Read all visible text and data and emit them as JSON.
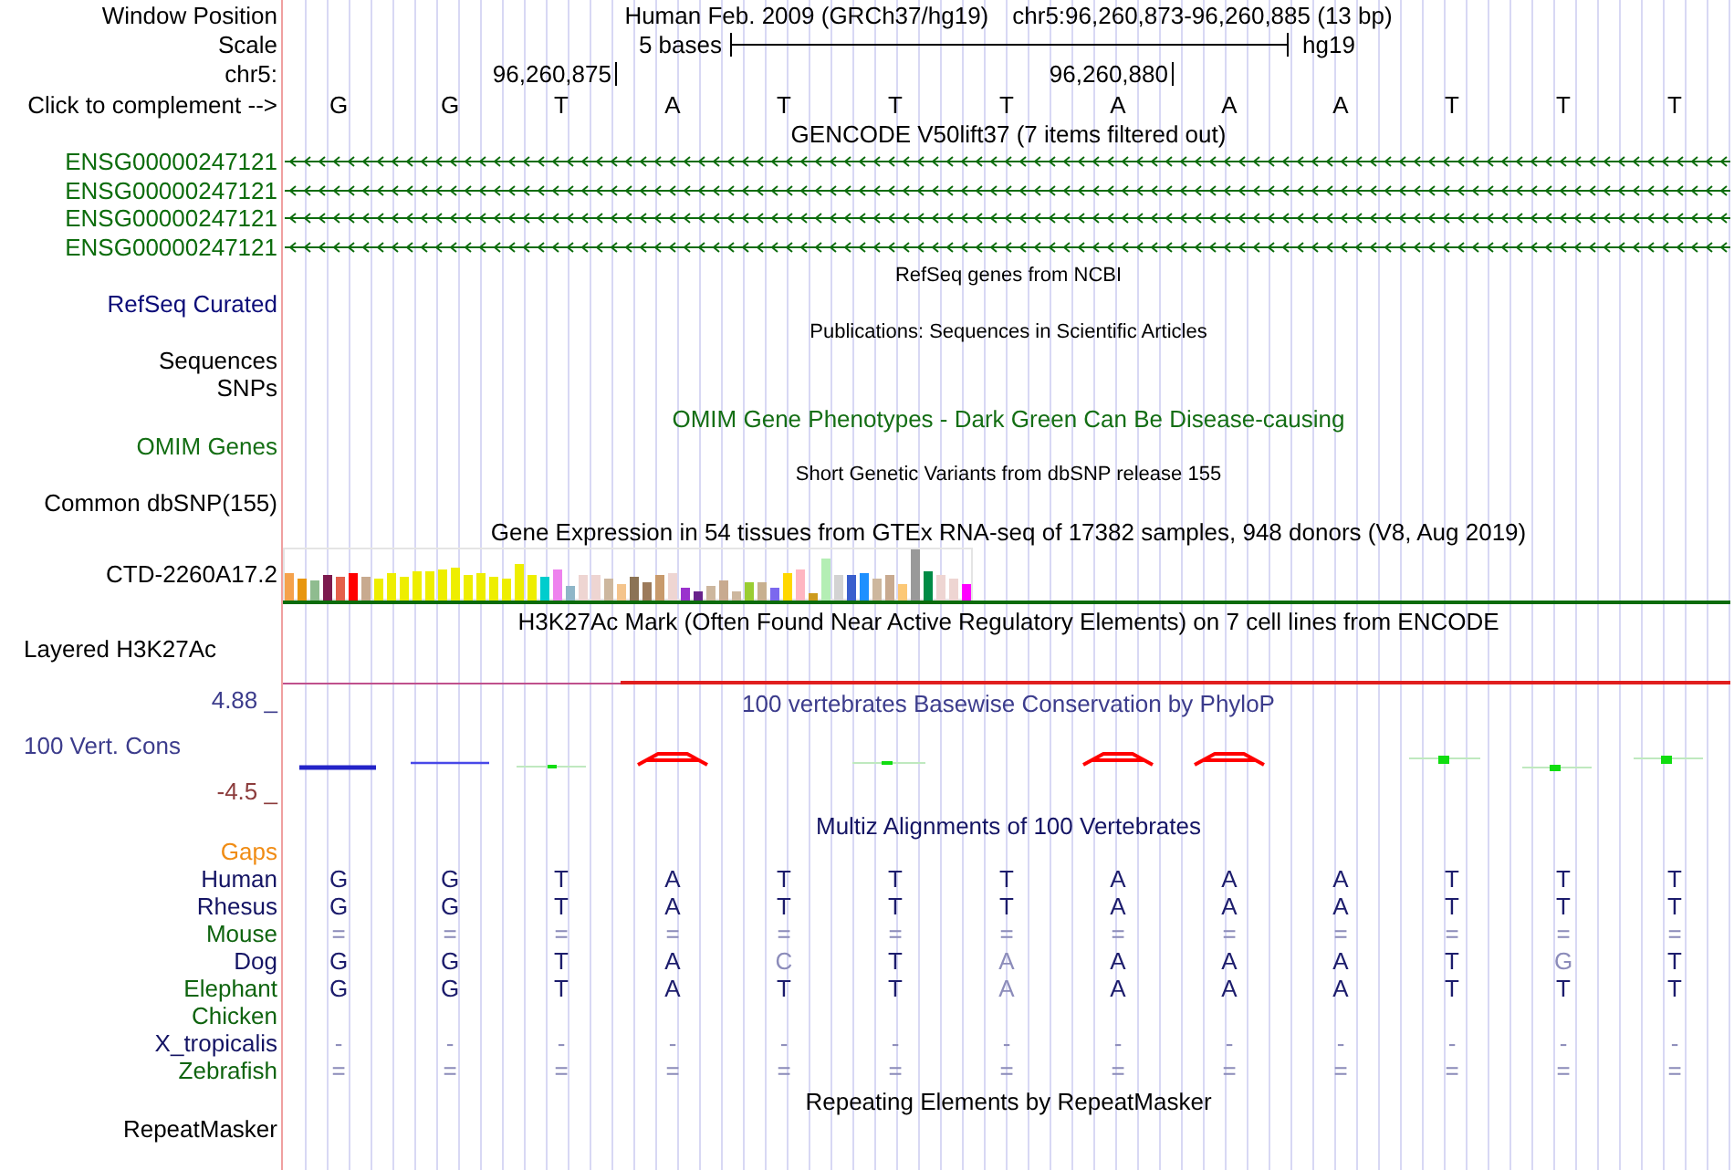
{
  "header": {
    "label": "Window Position",
    "title": "Human Feb. 2009 (GRCh37/hg19)",
    "position": "chr5:96,260,873-96,260,885 (13 bp)"
  },
  "scale": {
    "label": "Scale",
    "length": "5 bases",
    "assembly": "hg19"
  },
  "ruler": {
    "label": "chr5:",
    "ticks": [
      "96,260,875",
      "96,260,880"
    ]
  },
  "sequence": {
    "label": "Click to complement -->",
    "bases": [
      "G",
      "G",
      "T",
      "A",
      "T",
      "T",
      "T",
      "A",
      "A",
      "A",
      "T",
      "T",
      "T"
    ]
  },
  "tracks": [
    {
      "kind": "genes",
      "title": "GENCODE V50lift37 (7 items filtered out)",
      "color": "#0c6c0c",
      "items": [
        "ENSG00000247121",
        "ENSG00000247121",
        "ENSG00000247121",
        "ENSG00000247121"
      ]
    },
    {
      "kind": "empty",
      "title": "RefSeq genes from NCBI",
      "labels": [
        "RefSeq Curated"
      ],
      "color": "#0c0c78"
    },
    {
      "kind": "empty",
      "title": "Publications: Sequences in Scientific Articles",
      "labels": [
        "Sequences",
        "SNPs"
      ]
    },
    {
      "kind": "plain",
      "title": "OMIM Gene Phenotypes - Dark Green Can Be Disease-causing",
      "labels": [
        "OMIM Genes"
      ],
      "color": "#146e14"
    },
    {
      "kind": "empty",
      "title": "Short Genetic Variants from dbSNP release 155",
      "labels": [
        "Common dbSNP(155)"
      ]
    },
    {
      "kind": "expression",
      "title": "Gene Expression in 54 tissues from GTEx RNA-seq of 17382 samples, 948 donors (V8, Aug 2019)",
      "labels": [
        "CTD-2260A17.2"
      ]
    },
    {
      "kind": "signal",
      "title": "H3K27Ac Mark (Often Found Near Active Regulatory Elements) on 7 cell lines from ENCODE",
      "labels": [
        "Layered H3K27Ac"
      ]
    },
    {
      "kind": "conservation",
      "title": "100 vertebrates Basewise Conservation by PhyloP",
      "labels": [
        "100 Vert. Cons"
      ],
      "color": "#3c3c8c",
      "axis": [
        {
          "text": "4.88 _",
          "color": "#3c3c8c"
        },
        {
          "text": "-4.5 _",
          "color": "#8c3c3c"
        }
      ]
    },
    {
      "kind": "alignment",
      "title": "Multiz Alignments of 100 Vertebrates",
      "color": "#141464",
      "gaps": {
        "label": "Gaps",
        "color": "#f08c14"
      },
      "species": [
        {
          "name": "Human",
          "color": "#141464",
          "bases": [
            {
              "base": "G",
              "faded": false
            },
            {
              "base": "G",
              "faded": false
            },
            {
              "base": "T",
              "faded": false
            },
            {
              "base": "A",
              "faded": false
            },
            {
              "base": "T",
              "faded": false
            },
            {
              "base": "T",
              "faded": false
            },
            {
              "base": "T",
              "faded": false
            },
            {
              "base": "A",
              "faded": false
            },
            {
              "base": "A",
              "faded": false
            },
            {
              "base": "A",
              "faded": false
            },
            {
              "base": "T",
              "faded": false
            },
            {
              "base": "T",
              "faded": false
            },
            {
              "base": "T",
              "faded": false
            }
          ]
        },
        {
          "name": "Rhesus",
          "color": "#141464",
          "bases": [
            {
              "base": "G",
              "faded": false
            },
            {
              "base": "G",
              "faded": false
            },
            {
              "base": "T",
              "faded": false
            },
            {
              "base": "A",
              "faded": false
            },
            {
              "base": "T",
              "faded": false
            },
            {
              "base": "T",
              "faded": false
            },
            {
              "base": "T",
              "faded": false
            },
            {
              "base": "A",
              "faded": false
            },
            {
              "base": "A",
              "faded": false
            },
            {
              "base": "A",
              "faded": false
            },
            {
              "base": "T",
              "faded": false
            },
            {
              "base": "T",
              "faded": false
            },
            {
              "base": "T",
              "faded": false
            }
          ]
        },
        {
          "name": "Mouse",
          "color": "#0f640f",
          "bases": [
            {
              "base": "=",
              "faded": true
            },
            {
              "base": "=",
              "faded": true
            },
            {
              "base": "=",
              "faded": true
            },
            {
              "base": "=",
              "faded": true
            },
            {
              "base": "=",
              "faded": true
            },
            {
              "base": "=",
              "faded": true
            },
            {
              "base": "=",
              "faded": true
            },
            {
              "base": "=",
              "faded": true
            },
            {
              "base": "=",
              "faded": true
            },
            {
              "base": "=",
              "faded": true
            },
            {
              "base": "=",
              "faded": true
            },
            {
              "base": "=",
              "faded": true
            },
            {
              "base": "=",
              "faded": true
            }
          ]
        },
        {
          "name": "Dog",
          "color": "#141464",
          "bases": [
            {
              "base": "G",
              "faded": false
            },
            {
              "base": "G",
              "faded": false
            },
            {
              "base": "T",
              "faded": false
            },
            {
              "base": "A",
              "faded": false
            },
            {
              "base": "C",
              "faded": true
            },
            {
              "base": "T",
              "faded": false
            },
            {
              "base": "A",
              "faded": true
            },
            {
              "base": "A",
              "faded": false
            },
            {
              "base": "A",
              "faded": false
            },
            {
              "base": "A",
              "faded": false
            },
            {
              "base": "T",
              "faded": false
            },
            {
              "base": "G",
              "faded": true
            },
            {
              "base": "T",
              "faded": false
            }
          ]
        },
        {
          "name": "Elephant",
          "color": "#0f640f",
          "bases": [
            {
              "base": "G",
              "faded": false
            },
            {
              "base": "G",
              "faded": false
            },
            {
              "base": "T",
              "faded": false
            },
            {
              "base": "A",
              "faded": false
            },
            {
              "base": "T",
              "faded": false
            },
            {
              "base": "T",
              "faded": false
            },
            {
              "base": "A",
              "faded": true
            },
            {
              "base": "A",
              "faded": false
            },
            {
              "base": "A",
              "faded": false
            },
            {
              "base": "A",
              "faded": false
            },
            {
              "base": "T",
              "faded": false
            },
            {
              "base": "T",
              "faded": false
            },
            {
              "base": "T",
              "faded": false
            }
          ]
        },
        {
          "name": "Chicken",
          "color": "#0f640f"
        },
        {
          "name": "X_tropicalis",
          "color": "#141464",
          "bases": [
            {
              "base": "-",
              "faded": true
            },
            {
              "base": "-",
              "faded": true
            },
            {
              "base": "-",
              "faded": true
            },
            {
              "base": "-",
              "faded": true
            },
            {
              "base": "-",
              "faded": true
            },
            {
              "base": "-",
              "faded": true
            },
            {
              "base": "-",
              "faded": true
            },
            {
              "base": "-",
              "faded": true
            },
            {
              "base": "-",
              "faded": true
            },
            {
              "base": "-",
              "faded": true
            },
            {
              "base": "-",
              "faded": true
            },
            {
              "base": "-",
              "faded": true
            },
            {
              "base": "-",
              "faded": true
            }
          ]
        },
        {
          "name": "Zebrafish",
          "color": "#0f640f",
          "bases": [
            {
              "base": "=",
              "faded": true
            },
            {
              "base": "=",
              "faded": true
            },
            {
              "base": "=",
              "faded": true
            },
            {
              "base": "=",
              "faded": true
            },
            {
              "base": "=",
              "faded": true
            },
            {
              "base": "=",
              "faded": true
            },
            {
              "base": "=",
              "faded": true
            },
            {
              "base": "=",
              "faded": true
            },
            {
              "base": "=",
              "faded": true
            },
            {
              "base": "=",
              "faded": true
            },
            {
              "base": "=",
              "faded": true
            },
            {
              "base": "=",
              "faded": true
            },
            {
              "base": "=",
              "faded": true
            }
          ]
        }
      ]
    },
    {
      "kind": "plain",
      "title": "Repeating Elements by RepeatMasker",
      "labels": [
        "RepeatMasker"
      ]
    }
  ]
}
